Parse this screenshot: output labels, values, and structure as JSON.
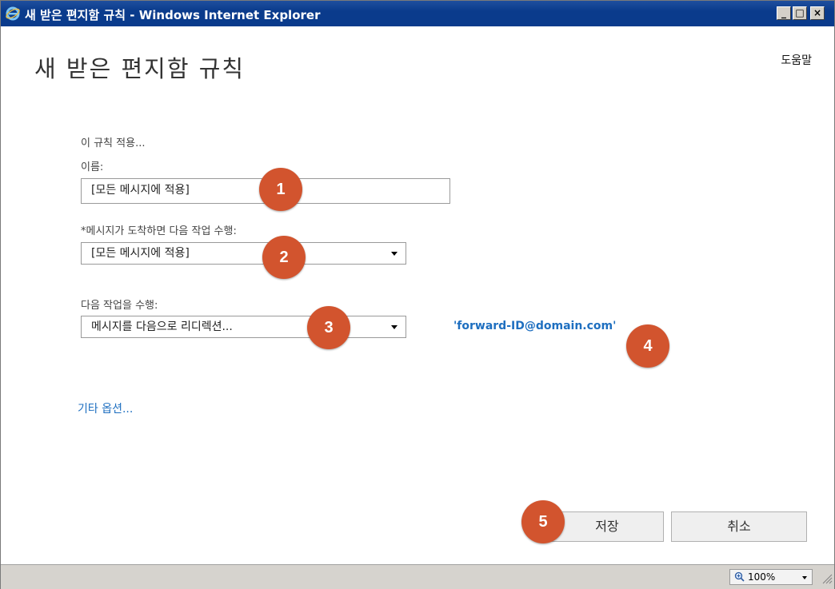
{
  "window": {
    "title": "새 받은 편지함 규칙 - Windows Internet Explorer",
    "minimize_glyph": "_",
    "maximize_glyph": "□",
    "close_glyph": "×"
  },
  "header": {
    "page_title": "새 받은 편지함 규칙",
    "help_label": "도움말"
  },
  "form": {
    "section_label": "이 규칙 적용...",
    "name_label": "이름:",
    "name_value": "[모든 메시지에 적용]",
    "condition_label": "*메시지가 도착하면 다음 작업 수행:",
    "condition_value": "[모든 메시지에 적용]",
    "action_label": "다음 작업을 수행:",
    "action_value": "메시지를 다음으로 리디렉션...",
    "redirect_target": "'forward-ID@domain.com'",
    "more_options": "기타 옵션..."
  },
  "buttons": {
    "save": "저장",
    "cancel": "취소"
  },
  "badges": [
    "1",
    "2",
    "3",
    "4",
    "5"
  ],
  "statusbar": {
    "zoom": "100%"
  },
  "colors": {
    "titlebar": "#0a3b8c",
    "badge": "#d2542e",
    "link": "#1e6fc0"
  },
  "icons": {
    "browser": "internet-explorer-icon",
    "zoom": "zoom-icon",
    "dropdown": "chevron-down-icon",
    "grip": "resize-grip-icon"
  }
}
